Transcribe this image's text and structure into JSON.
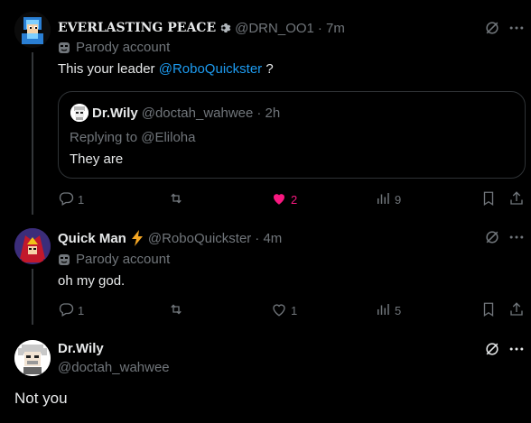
{
  "colors": {
    "background": "#000000",
    "accent": "#1d9bf0",
    "like": "#f91880",
    "muted": "#71767b",
    "text": "#e7e9ea"
  },
  "tweets": [
    {
      "display_name": "EVERLASTING PEACE",
      "handle": "@DRN_OO1",
      "time": "· 7m",
      "label": "Parody account",
      "text_prefix": "This your leader ",
      "mention": "@RoboQuickster",
      "text_suffix": " ?",
      "quote": {
        "display_name": "Dr.Wily",
        "handle": "@doctah_wahwee",
        "time": "· 2h",
        "reply_label": "Replying to ",
        "reply_mention": "@Eliloha",
        "text": "They are"
      },
      "replies": "1",
      "retweets": "",
      "likes": "2",
      "views": "9",
      "liked": true
    },
    {
      "display_name": "Quick Man",
      "handle": "@RoboQuickster",
      "time": "· 4m",
      "label": "Parody account",
      "text": "oh my god.",
      "replies": "1",
      "retweets": "",
      "likes": "1",
      "views": "5",
      "liked": false
    }
  ],
  "composer": {
    "display_name": "Dr.Wily",
    "handle": "@doctah_wahwee",
    "text": "Not you"
  },
  "icons": [
    "grok-icon",
    "more-icon",
    "parody-mask-icon",
    "reply-icon",
    "retweet-icon",
    "like-icon",
    "views-icon",
    "bookmark-icon",
    "share-icon",
    "verified-gear-icon",
    "lightning-icon"
  ]
}
